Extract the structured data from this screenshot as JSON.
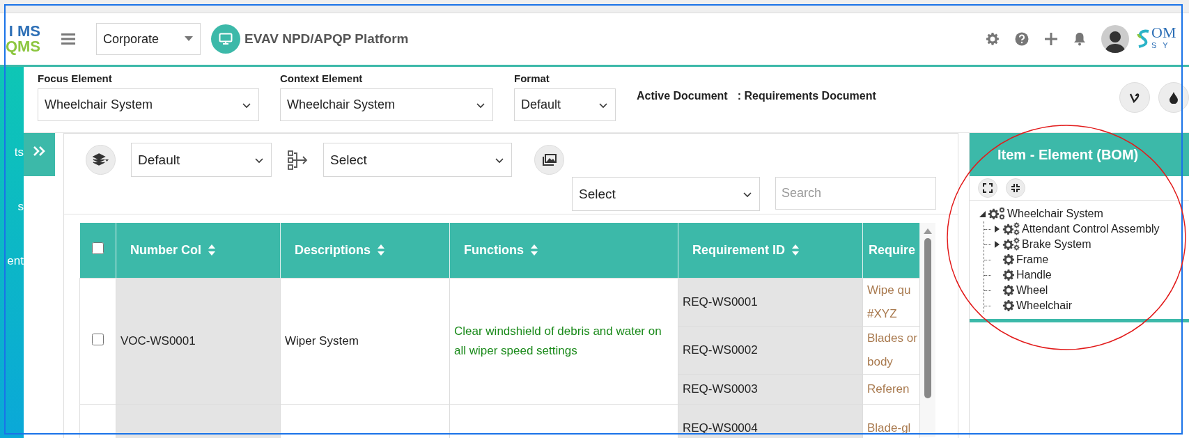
{
  "header": {
    "logo_top": "I MS",
    "logo_bottom": "QMS",
    "org_select": "Corporate",
    "app_title": "EVAV NPD/APQP Platform",
    "brand_top": "OM",
    "brand_bottom": "S Y"
  },
  "sidebar": {
    "items": [
      "ts",
      "s",
      "ent"
    ]
  },
  "filters": [
    {
      "label": "Focus Element",
      "value": "Wheelchair System"
    },
    {
      "label": "Context Element",
      "value": "Wheelchair System"
    },
    {
      "label": "Format",
      "value": "Default"
    }
  ],
  "active_document": {
    "label": "Active Document",
    "value": ": Requirements Document"
  },
  "toolbar": {
    "view_select": "Default",
    "group_select": "Select",
    "filter_select": "Select",
    "search": {
      "placeholder": "Search"
    }
  },
  "table": {
    "select_all_checked": false,
    "columns": [
      {
        "label": "Number Col",
        "sortable": true
      },
      {
        "label": "Descriptions",
        "sortable": true
      },
      {
        "label": "Functions",
        "sortable": true
      },
      {
        "label": "Requirement ID",
        "sortable": true
      },
      {
        "label": "Require",
        "sortable": false
      }
    ],
    "rows": [
      {
        "checked": false,
        "number": "VOC-WS0001",
        "description": "Wiper System",
        "function": "Clear windshield of debris and water on all wiper speed settings",
        "requirements": [
          {
            "id": "REQ-WS0001",
            "text": "Wipe qu #XYZ"
          },
          {
            "id": "REQ-WS0002",
            "text": "Blades or body"
          },
          {
            "id": "REQ-WS0003",
            "text": "Referen"
          }
        ]
      },
      {
        "number": "",
        "description": "",
        "function": "",
        "requirements": [
          {
            "id": "REQ-WS0004",
            "text": "Blade-gl"
          }
        ]
      }
    ]
  },
  "bom_panel": {
    "title": "Item - Element (BOM)",
    "tree": [
      {
        "label": "Wheelchair System",
        "kind": "assembly",
        "expanded": true,
        "children": [
          {
            "label": "Attendant Control Assembly",
            "kind": "assembly",
            "expanded": false
          },
          {
            "label": "Brake System",
            "kind": "assembly",
            "expanded": false
          },
          {
            "label": "Frame",
            "kind": "part"
          },
          {
            "label": "Handle",
            "kind": "part"
          },
          {
            "label": "Wheel",
            "kind": "part"
          },
          {
            "label": "Wheelchair",
            "kind": "part"
          }
        ]
      }
    ]
  }
}
